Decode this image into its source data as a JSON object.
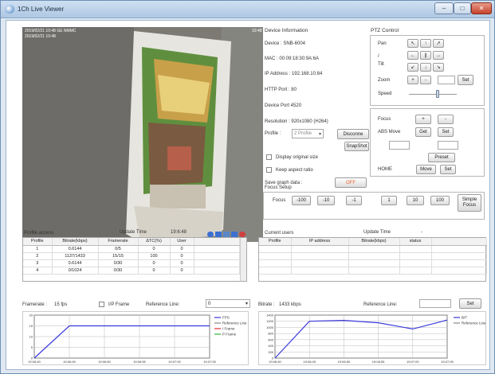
{
  "window": {
    "title": "1Ch Live Viewer",
    "minimize": "–",
    "maximize": "□",
    "close": "✕"
  },
  "video": {
    "overlay_line1": "2019/02/21 10:48 GE NMMC",
    "overlay_line2": "2019/02/21 10:48",
    "overlay_right": "10:48"
  },
  "device_info": {
    "title": "Device Information",
    "device": "Device :   SNB-6004",
    "mac": "MAC :     00:09:18:30:9A:6A",
    "ip": "IP Address : 192.168.10.84",
    "http": "HTTP Port :  80",
    "port": "Device Port  4520",
    "resolution": "Resolution :  920x1080 (H264)",
    "profile_label": "Profile :",
    "profile_value": "2 Profile",
    "disconnect": "Disconne",
    "snapshot": "SnapShot",
    "display_original": "Display original size",
    "keep_aspect": "Keep aspect ratio",
    "save_graph": "Save graph data :",
    "save_graph_value": "OFF"
  },
  "ptz": {
    "title": "PTZ Control",
    "pan": "Pan",
    "slash": "/",
    "tilt": "Tilt",
    "zoom": "Zoom",
    "speed": "Speed",
    "set": "Set",
    "arrows": [
      "↖",
      "↑",
      "↗",
      "←",
      "||",
      "→",
      "↙",
      "↓",
      "↘"
    ],
    "zoom_plus": "+",
    "zoom_minus": "-",
    "focus": "Focus",
    "focus_plus": "+",
    "focus_minus": "-",
    "abs_move": "ABS Move",
    "get": "Get",
    "set2": "Set",
    "preset": "Preset",
    "home": "HOME",
    "move": "Move",
    "set3": "Set"
  },
  "focus_setup": {
    "title": "Focus Setup",
    "label": "Focus",
    "buttons": [
      "-100",
      "-10",
      "-1",
      "1",
      "10",
      "100"
    ],
    "simple_focus_line1": "Simple",
    "simple_focus_line2": "Focus"
  },
  "profile_access": {
    "title": "Profile access",
    "update_time_label": "Update Time",
    "update_time_value": "19:6:48",
    "headers": [
      "Profile",
      "Bitrate(kbps)",
      "Framerate",
      "ΔTC(%)",
      "User"
    ],
    "rows": [
      [
        "1",
        "0.6144",
        "0/5",
        "0",
        "0"
      ],
      [
        "2",
        "1137/1433",
        "15/15",
        "100",
        "0"
      ],
      [
        "3",
        "0.6144",
        "0/30",
        "0",
        "0"
      ],
      [
        "4",
        "0/1024",
        "0/30",
        "0",
        "0"
      ]
    ]
  },
  "current_users": {
    "title": "Current users",
    "update_time_label": "Update Time",
    "update_time_value": "-",
    "headers": [
      "Profile",
      "IP address",
      "Bitrate(kbps)",
      "status"
    ]
  },
  "framerate_panel": {
    "label": "Framerate :",
    "value": "15  fps",
    "iframe_label": "I/P Frame",
    "ref_label": "Reference Line:",
    "ref_value": "0"
  },
  "bitrate_panel": {
    "label": "Bitrate :",
    "value": "1433  kbps",
    "ref_label": "Reference Line:",
    "set": "Set"
  },
  "chart_data": [
    {
      "type": "line",
      "name": "framerate",
      "x": [
        "19:06:40",
        "19:06:45",
        "19:06:50",
        "19:06:55",
        "19:07:00",
        "19:07:05"
      ],
      "yticks": [
        "20",
        "15",
        "10",
        "5",
        "0"
      ],
      "ylim": [
        0,
        20
      ],
      "series": [
        {
          "name": "FPS",
          "color": "#3a3adc",
          "values": [
            0,
            15,
            15,
            15,
            15,
            15
          ]
        }
      ],
      "legend": [
        "FPS",
        "Reference Line",
        "I Frame",
        "P Frame"
      ],
      "legend_colors": [
        "#3a3adc",
        "#888888",
        "#e03030",
        "#30b030"
      ]
    },
    {
      "type": "line",
      "name": "bitrate",
      "x": [
        "19:06:40",
        "19:06:45",
        "19:06:50",
        "19:06:55",
        "19:07:00",
        "19:07:05"
      ],
      "yticks": [
        "1400",
        "1200",
        "1000",
        "800",
        "600",
        "400",
        "200",
        "0"
      ],
      "ylim": [
        0,
        1400
      ],
      "series": [
        {
          "name": "BIT",
          "color": "#3a3adc",
          "values": [
            0,
            1200,
            1230,
            1150,
            950,
            1240
          ]
        }
      ],
      "legend": [
        "BIT",
        "Reference Line"
      ],
      "legend_colors": [
        "#3a3adc",
        "#888888"
      ]
    }
  ]
}
